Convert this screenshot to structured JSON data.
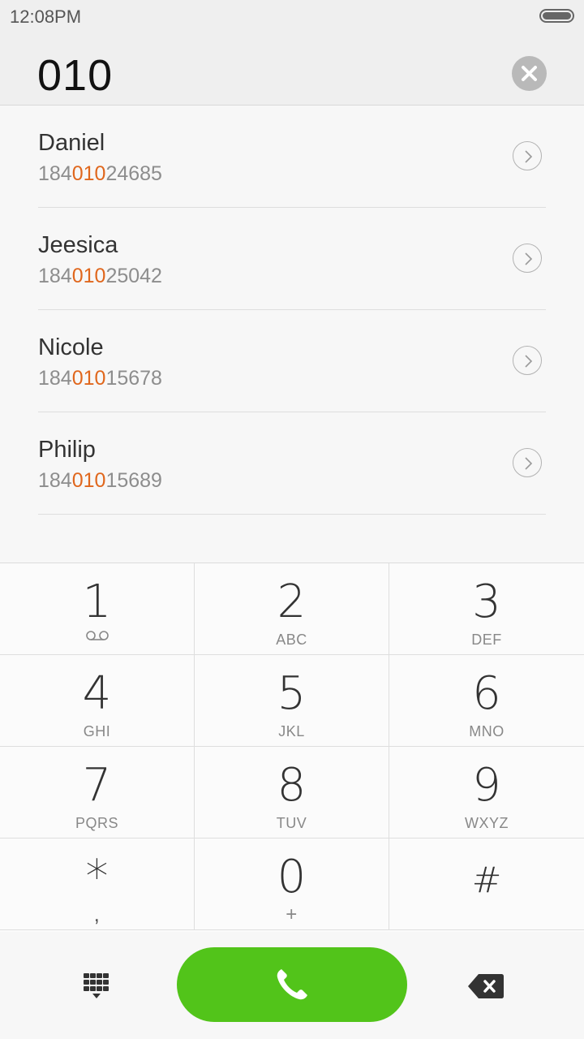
{
  "status_bar": {
    "time": "12:08PM"
  },
  "dialer": {
    "input_value": "010"
  },
  "contacts": [
    {
      "name": "Daniel",
      "number_pre": "184",
      "number_match": "010",
      "number_post": "24685"
    },
    {
      "name": "Jeesica",
      "number_pre": "184",
      "number_match": "010",
      "number_post": "25042"
    },
    {
      "name": "Nicole",
      "number_pre": "184",
      "number_match": "010",
      "number_post": "15678"
    },
    {
      "name": "Philip",
      "number_pre": "184",
      "number_match": "010",
      "number_post": "15689"
    }
  ],
  "keypad": {
    "keys": [
      {
        "digit": "1",
        "letters": "",
        "icon": "voicemail-icon"
      },
      {
        "digit": "2",
        "letters": "ABC"
      },
      {
        "digit": "3",
        "letters": "DEF"
      },
      {
        "digit": "4",
        "letters": "GHI"
      },
      {
        "digit": "5",
        "letters": "JKL"
      },
      {
        "digit": "6",
        "letters": "MNO"
      },
      {
        "digit": "7",
        "letters": "PQRS"
      },
      {
        "digit": "8",
        "letters": "TUV"
      },
      {
        "digit": "9",
        "letters": "WXYZ"
      },
      {
        "digit": "*",
        "letters": ","
      },
      {
        "digit": "0",
        "letters": "+"
      },
      {
        "digit": "#",
        "letters": ""
      }
    ]
  },
  "icons": {
    "clear": "clear-circle-icon",
    "detail": "chevron-right-circle-icon",
    "dialpad": "dialpad-icon",
    "call": "phone-icon",
    "backspace": "backspace-icon"
  },
  "colors": {
    "match_highlight": "#e0671d",
    "call_button": "#52c41a"
  }
}
